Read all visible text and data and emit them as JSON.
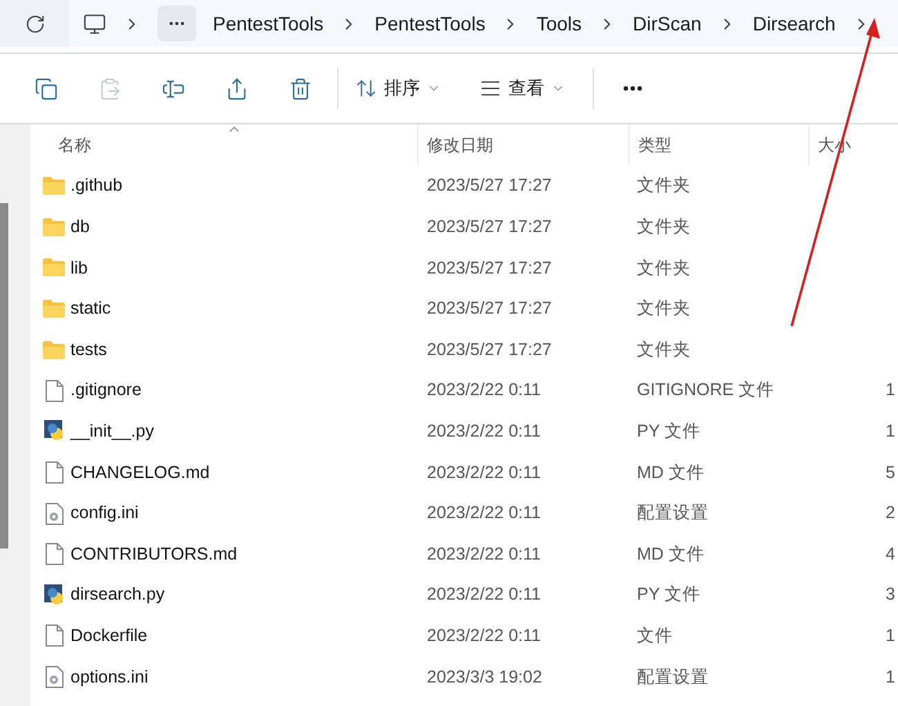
{
  "address_bar": {
    "breadcrumb": [
      "PentestTools",
      "PentestTools",
      "Tools",
      "DirScan",
      "Dirsearch"
    ]
  },
  "toolbar": {
    "actions": [
      {
        "kind": "copy",
        "disabled": false
      },
      {
        "kind": "paste",
        "disabled": true
      },
      {
        "kind": "rename",
        "disabled": false
      },
      {
        "kind": "share",
        "disabled": false
      },
      {
        "kind": "delete",
        "disabled": false
      }
    ],
    "sort_label": "排序",
    "view_label": "查看"
  },
  "table": {
    "columns": [
      "名称",
      "修改日期",
      "类型",
      "大小"
    ],
    "rows": [
      {
        "name": ".github",
        "date": "2023/5/27 17:27",
        "type": "文件夹",
        "kind": "folder"
      },
      {
        "name": "db",
        "date": "2023/5/27 17:27",
        "type": "文件夹",
        "kind": "folder"
      },
      {
        "name": "lib",
        "date": "2023/5/27 17:27",
        "type": "文件夹",
        "kind": "folder"
      },
      {
        "name": "static",
        "date": "2023/5/27 17:27",
        "type": "文件夹",
        "kind": "folder"
      },
      {
        "name": "tests",
        "date": "2023/5/27 17:27",
        "type": "文件夹",
        "kind": "folder"
      },
      {
        "name": ".gitignore",
        "date": "2023/2/22 0:11",
        "type": "GITIGNORE 文件",
        "size": "1",
        "kind": "file"
      },
      {
        "name": "__init__.py",
        "date": "2023/2/22 0:11",
        "type": "PY 文件",
        "size": "1",
        "kind": "python"
      },
      {
        "name": "CHANGELOG.md",
        "date": "2023/2/22 0:11",
        "type": "MD 文件",
        "size": "5",
        "kind": "file"
      },
      {
        "name": "config.ini",
        "date": "2023/2/22 0:11",
        "type": "配置设置",
        "size": "2",
        "kind": "settings"
      },
      {
        "name": "CONTRIBUTORS.md",
        "date": "2023/2/22 0:11",
        "type": "MD 文件",
        "size": "4",
        "kind": "file"
      },
      {
        "name": "dirsearch.py",
        "date": "2023/2/22 0:11",
        "type": "PY 文件",
        "size": "3",
        "kind": "python"
      },
      {
        "name": "Dockerfile",
        "date": "2023/2/22 0:11",
        "type": "文件",
        "size": "1",
        "kind": "file"
      },
      {
        "name": "options.ini",
        "date": "2023/3/3 19:02",
        "type": "配置设置",
        "size": "1",
        "kind": "settings"
      }
    ]
  }
}
